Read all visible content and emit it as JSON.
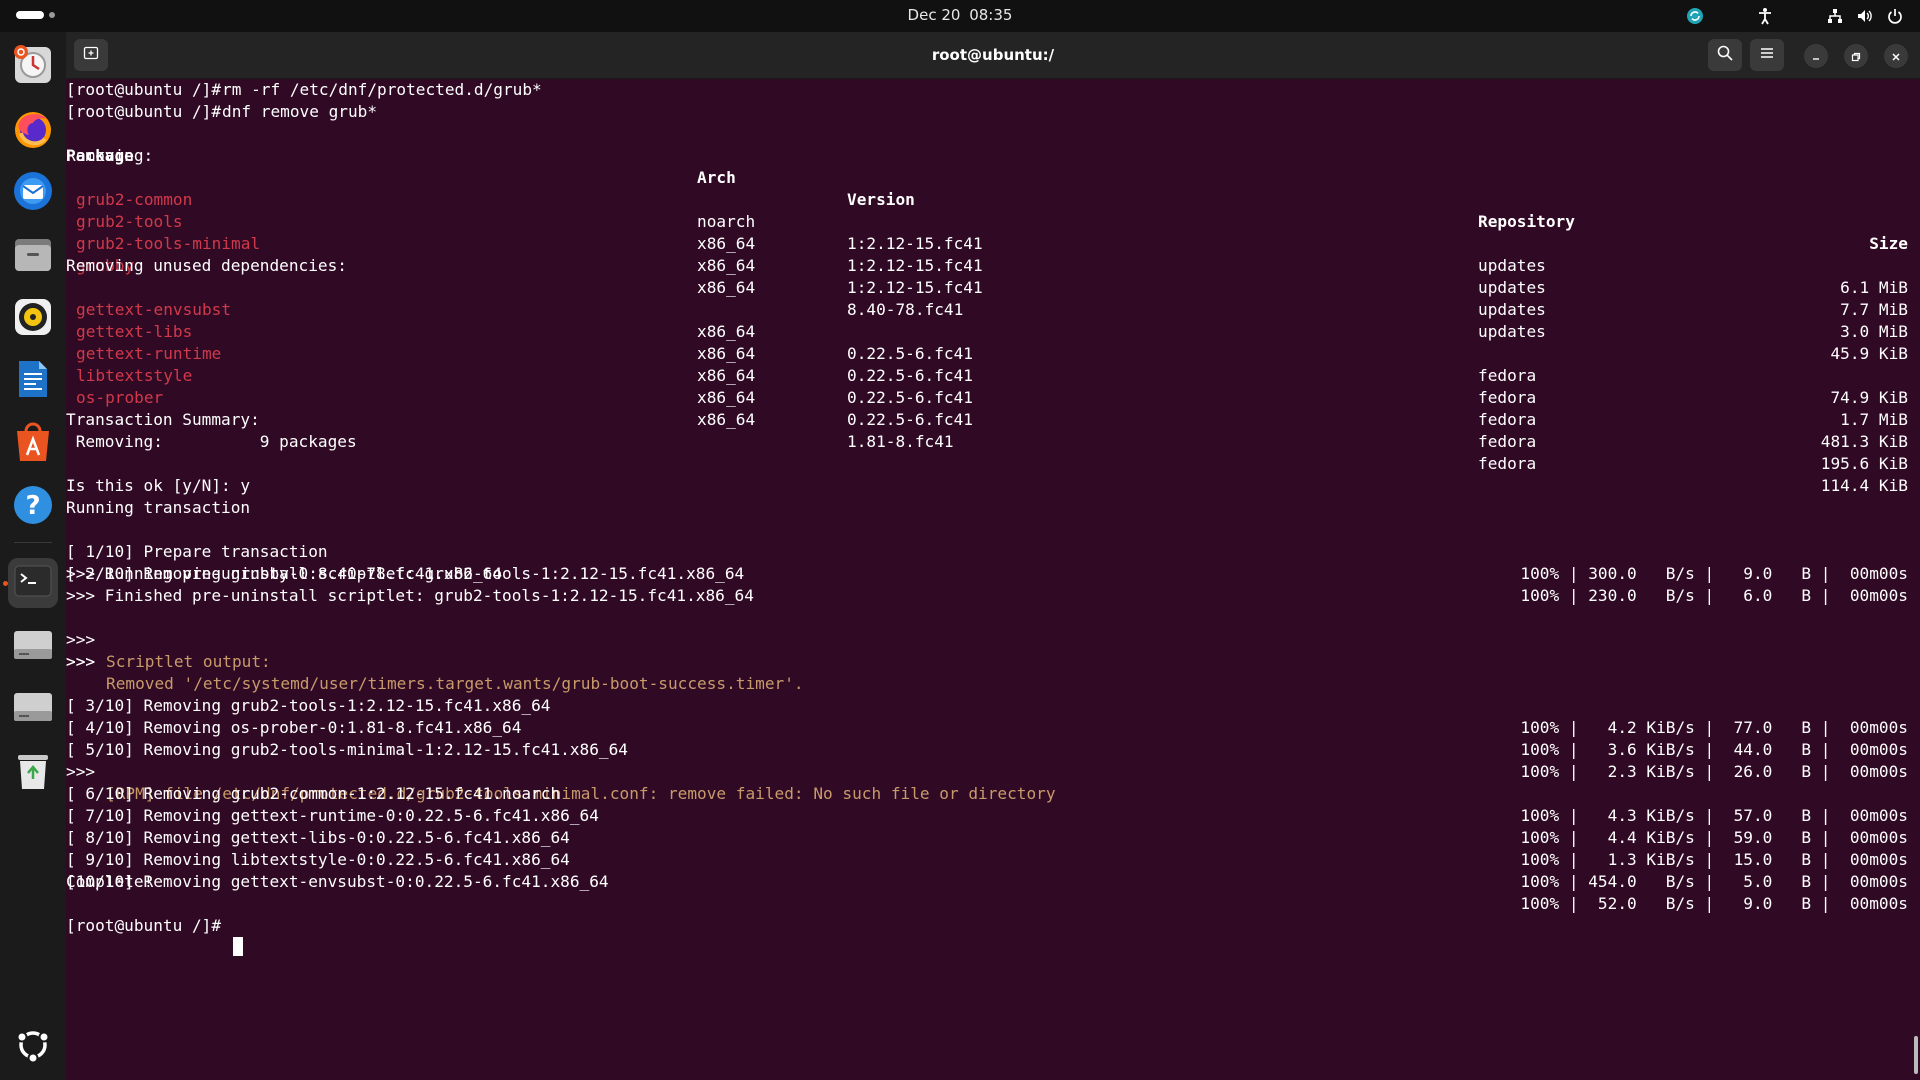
{
  "topbar": {
    "date": "Dec 20",
    "time": "08:35"
  },
  "dock": {
    "items": [
      {
        "name": "ubuntu-upgrade",
        "icon": "update-notifier-icon"
      },
      {
        "name": "firefox",
        "icon": "firefox-icon"
      },
      {
        "name": "thunderbird",
        "icon": "thunderbird-icon"
      },
      {
        "name": "files",
        "icon": "files-icon"
      },
      {
        "name": "rhythmbox",
        "icon": "rhythmbox-icon"
      },
      {
        "name": "writer",
        "icon": "libreoffice-writer-icon"
      },
      {
        "name": "app-center",
        "icon": "app-center-icon"
      },
      {
        "name": "help",
        "icon": "help-icon"
      },
      {
        "name": "terminal",
        "icon": "terminal-icon"
      },
      {
        "name": "drive-1",
        "icon": "drive-icon"
      },
      {
        "name": "drive-2",
        "icon": "drive-icon"
      },
      {
        "name": "trash",
        "icon": "trash-icon"
      }
    ],
    "show_apps_icon": "show-apps-icon",
    "accent": "#e95420"
  },
  "window": {
    "title": "root@ubuntu:/"
  },
  "colors": {
    "terminal_bg": "#300a24",
    "package_red": "#d0394b",
    "scriptlet_orange": "#c89a6a"
  },
  "terminal": {
    "prompt": "[root@ubuntu /]#",
    "cmd1": "rm -rf /etc/dnf/protected.d/grub*",
    "cmd2": "dnf remove grub*",
    "headers": {
      "package": "Package",
      "arch": "Arch",
      "version": "Version",
      "repository": "Repository",
      "size": "Size"
    },
    "removing_label": "Removing:",
    "unused_label": "Removing unused dependencies:",
    "packages": [
      {
        "name": "grub2-common",
        "arch": "noarch",
        "version": "1:2.12-15.fc41",
        "repo": "updates",
        "size": "6.1 MiB"
      },
      {
        "name": "grub2-tools",
        "arch": "x86_64",
        "version": "1:2.12-15.fc41",
        "repo": "updates",
        "size": "7.7 MiB"
      },
      {
        "name": "grub2-tools-minimal",
        "arch": "x86_64",
        "version": "1:2.12-15.fc41",
        "repo": "updates",
        "size": "3.0 MiB"
      },
      {
        "name": "grubby",
        "arch": "x86_64",
        "version": "8.40-78.fc41",
        "repo": "updates",
        "size": "45.9 KiB"
      }
    ],
    "deps": [
      {
        "name": "gettext-envsubst",
        "arch": "x86_64",
        "version": "0.22.5-6.fc41",
        "repo": "fedora",
        "size": "74.9 KiB"
      },
      {
        "name": "gettext-libs",
        "arch": "x86_64",
        "version": "0.22.5-6.fc41",
        "repo": "fedora",
        "size": "1.7 MiB"
      },
      {
        "name": "gettext-runtime",
        "arch": "x86_64",
        "version": "0.22.5-6.fc41",
        "repo": "fedora",
        "size": "481.3 KiB"
      },
      {
        "name": "libtextstyle",
        "arch": "x86_64",
        "version": "0.22.5-6.fc41",
        "repo": "fedora",
        "size": "195.6 KiB"
      },
      {
        "name": "os-prober",
        "arch": "x86_64",
        "version": "1.81-8.fc41",
        "repo": "fedora",
        "size": "114.4 KiB"
      }
    ],
    "summary_label": "Transaction Summary:",
    "summary_removing": " Removing:          9 packages",
    "confirm": "Is this ok [y/N]: y",
    "running": "Running transaction",
    "tx": [
      {
        "text": "[ 1/10] Prepare transaction",
        "stats": "100% | 300.0   B/s |   9.0   B |  00m00s"
      },
      {
        "text": "[ 2/10] Removing grubby-0:8.40-78.fc41.x86_64",
        "stats": "100% | 230.0   B/s |   6.0   B |  00m00s"
      }
    ],
    "scriptlet_running": ">>> Running pre-uninstall scriptlet: grub2-tools-1:2.12-15.fc41.x86_64",
    "scriptlet_finished": ">>> Finished pre-uninstall scriptlet: grub2-tools-1:2.12-15.fc41.x86_64",
    "scriptlet_output_prefix": ">>> ",
    "scriptlet_output": "Scriptlet output:",
    "scriptlet_removed_prefix": ">>> ",
    "scriptlet_removed": "Removed '/etc/systemd/user/timers.target.wants/grub-boot-success.timer'.",
    "scriptlet_end": ">>>",
    "tx2": [
      {
        "text": "[ 3/10] Removing grub2-tools-1:2.12-15.fc41.x86_64",
        "stats": "100% |   4.2 KiB/s |  77.0   B |  00m00s"
      },
      {
        "text": "[ 4/10] Removing os-prober-0:1.81-8.fc41.x86_64",
        "stats": "100% |   3.6 KiB/s |  44.0   B |  00m00s"
      },
      {
        "text": "[ 5/10] Removing grub2-tools-minimal-1:2.12-15.fc41.x86_64",
        "stats": "100% |   2.3 KiB/s |  26.0   B |  00m00s"
      }
    ],
    "rpm_prefix": ">>> ",
    "rpm_warning": "[RPM] file /etc/dnf/protected.d/grub2-tools-minimal.conf: remove failed: No such file or directory",
    "tx3": [
      {
        "text": "[ 6/10] Removing grub2-common-1:2.12-15.fc41.noarch",
        "stats": "100% |   4.3 KiB/s |  57.0   B |  00m00s"
      },
      {
        "text": "[ 7/10] Removing gettext-runtime-0:0.22.5-6.fc41.x86_64",
        "stats": "100% |   4.4 KiB/s |  59.0   B |  00m00s"
      },
      {
        "text": "[ 8/10] Removing gettext-libs-0:0.22.5-6.fc41.x86_64",
        "stats": "100% |   1.3 KiB/s |  15.0   B |  00m00s"
      },
      {
        "text": "[ 9/10] Removing libtextstyle-0:0.22.5-6.fc41.x86_64",
        "stats": "100% | 454.0   B/s |   5.0   B |  00m00s"
      },
      {
        "text": "[10/10] Removing gettext-envsubst-0:0.22.5-6.fc41.x86_64",
        "stats": "100% |  52.0   B/s |   9.0   B |  00m00s"
      }
    ],
    "complete": "Complete!"
  }
}
